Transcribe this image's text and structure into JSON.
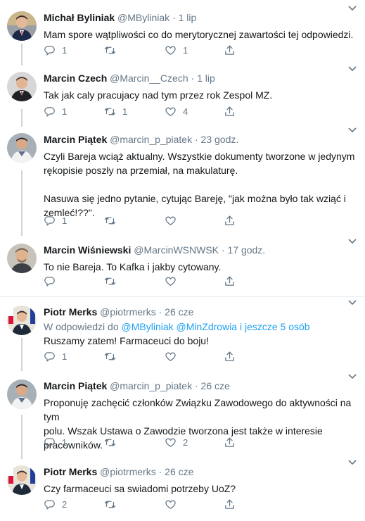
{
  "ui": {
    "icon_color": "#657786",
    "link_color": "#1da1f2",
    "thread_line_color": "#ccd6dd"
  },
  "tweets": [
    {
      "name": "Michał Byliniak",
      "handle": "@MByliniak",
      "dot": "·",
      "time": "1 lip",
      "lines": [
        "Mam spore wątpliwości co do merytorycznej zawartości tej odpowiedzi."
      ],
      "reply": "1",
      "retweet": "",
      "like": "1"
    },
    {
      "name": "Marcin Czech",
      "handle": "@Marcin__Czech",
      "dot": "·",
      "time": "1 lip",
      "lines": [
        "Tak jak caly pracujacy nad tym przez rok Zespol MZ."
      ],
      "reply": "1",
      "retweet": "1",
      "like": "4"
    },
    {
      "name": "Marcin Piątek",
      "handle": "@marcin_p_piatek",
      "dot": "·",
      "time": "23 godz.",
      "lines": [
        "Czyli Bareja wciąż aktualny. Wszystkie dokumenty tworzone w jedynym",
        "rękopisie poszły na przemiał, na makulaturę.",
        "",
        "Nasuwa się jedno pytanie, cytując Bareję, \"jak można było tak wziąć i",
        "zemleć!??\"."
      ],
      "reply": "1",
      "retweet": "",
      "like": ""
    },
    {
      "name": "Marcin Wiśniewski",
      "handle": "@MarcinWSNWSK",
      "dot": "·",
      "time": "17 godz.",
      "lines": [
        "To nie Bareja. To Kafka i jakby cytowany."
      ],
      "reply": "",
      "retweet": "",
      "like": ""
    },
    {
      "name": "Piotr Merks",
      "handle": "@piotrmerks",
      "dot": "·",
      "time": "26 cze",
      "reply_to_prefix": "W odpowiedzi do",
      "reply_to_links": "@MByliniak @MinZdrowia i jeszcze 5 osób",
      "lines": [
        "Ruszamy zatem! Farmaceuci do boju!"
      ],
      "reply": "1",
      "retweet": "",
      "like": ""
    },
    {
      "name": "Marcin Piątek",
      "handle": "@marcin_p_piatek",
      "dot": "·",
      "time": "26 cze",
      "lines": [
        "Proponuję zachęcić członków Związku Zawodowego do aktywności na tym",
        "polu. Wszak Ustawa o Zawodzie tworzona jest także w interesie",
        "pracowników."
      ],
      "reply": "1",
      "retweet": "",
      "like": "2"
    },
    {
      "name": "Piotr Merks",
      "handle": "@piotrmerks",
      "dot": "·",
      "time": "26 cze",
      "lines": [
        "Czy farmaceuci sa swiadomi potrzeby UoZ?"
      ],
      "reply": "2",
      "retweet": "",
      "like": ""
    }
  ]
}
